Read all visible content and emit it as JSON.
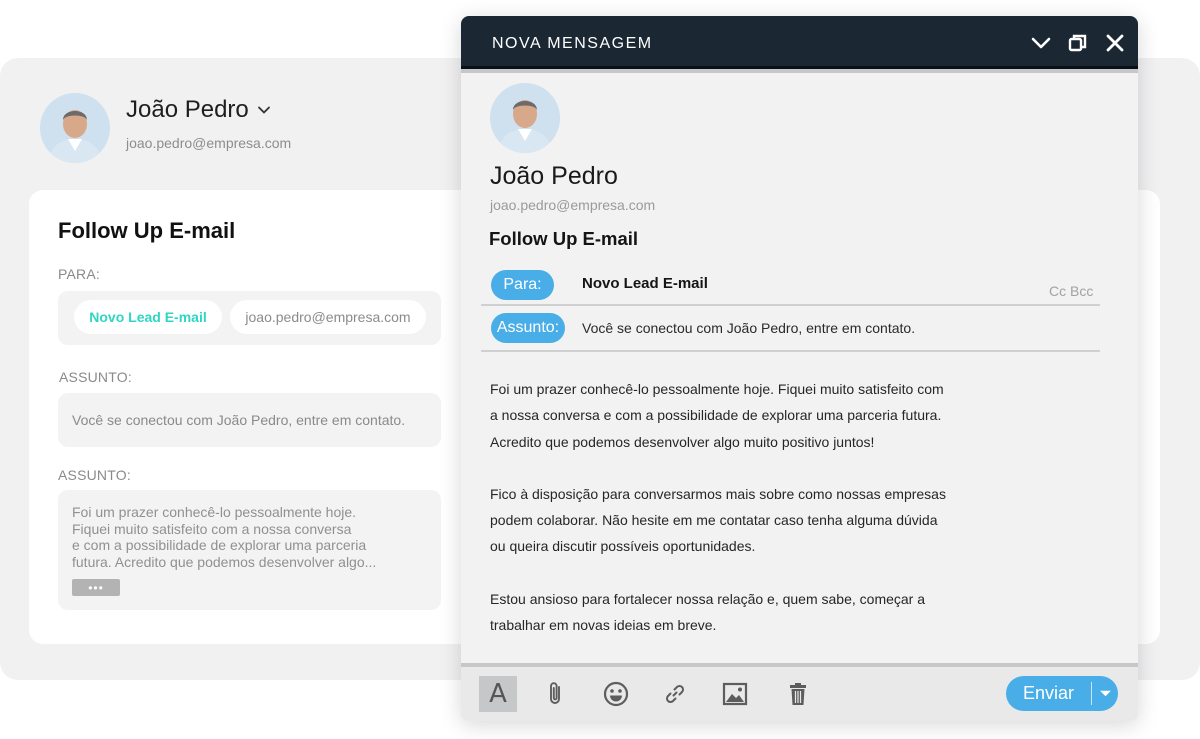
{
  "background": {
    "user": {
      "name": "João Pedro",
      "email": "joao.pedro@empresa.com"
    },
    "card": {
      "title": "Follow Up E-mail",
      "to_label": "PARA:",
      "to_chips": [
        "Novo Lead E-mail",
        "joao.pedro@empresa.com"
      ],
      "subject_label": "ASSUNTO:",
      "subject_value": "Você se conectou com João Pedro, entre em contato.",
      "body_label": "ASSUNTO:",
      "body_preview": [
        "Foi um prazer conhecê-lo pessoalmente hoje.",
        "Fiquei muito satisfeito com a nossa conversa",
        "e com a possibilidade de explorar uma parceria",
        "futura. Acredito que podemos desenvolver algo..."
      ],
      "more_label": "•••"
    }
  },
  "compose": {
    "window_title": "NOVA MENSAGEM",
    "controls": {
      "minimize": "chevron-down-icon",
      "maximize": "restore-icon",
      "close": "close-icon"
    },
    "sender": {
      "name": "João Pedro",
      "email": "joao.pedro@empresa.com"
    },
    "title": "Follow Up E-mail",
    "to_label": "Para:",
    "to_value": "Novo Lead E-mail",
    "cc_bcc": "Cc Bcc",
    "subject_label": "Assunto:",
    "subject_value": "Você se conectou com João Pedro, entre em contato.",
    "body_paragraphs": [
      [
        "Foi um prazer conhecê-lo pessoalmente hoje. Fiquei muito satisfeito com",
        "a nossa conversa e com a possibilidade de explorar uma parceria futura.",
        "Acredito que podemos desenvolver algo muito positivo juntos!"
      ],
      [
        "Fico à disposição para conversarmos mais sobre como nossas empresas",
        "podem colaborar. Não hesite em me contatar caso tenha alguma dúvida",
        "ou queira discutir possíveis oportunidades."
      ],
      [
        "Estou ansioso para fortalecer nossa relação e, quem sabe, começar a",
        "trabalhar em novas ideias em breve."
      ]
    ],
    "toolbar": {
      "format_glyph": "A",
      "tools": [
        "text-format-icon",
        "attachment-icon",
        "emoji-icon",
        "link-icon",
        "image-icon",
        "trash-icon"
      ],
      "send_label": "Enviar"
    }
  },
  "colors": {
    "accent": "#49aee8",
    "titlebar": "#1b2733",
    "chip_lead": "#2fd6c3"
  }
}
